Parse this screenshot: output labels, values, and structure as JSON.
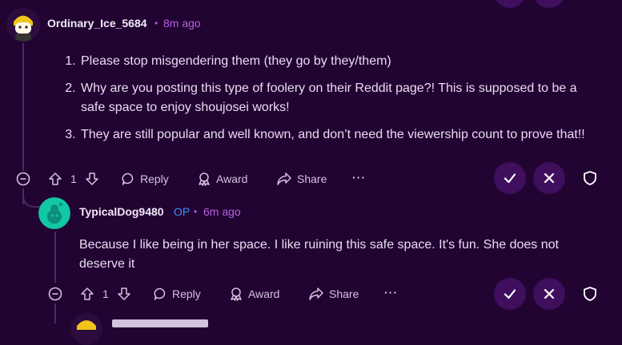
{
  "comments": [
    {
      "username": "Ordinary_Ice_5684",
      "separator": "•",
      "time": "8m ago",
      "list_items": [
        "Please stop misgendering them (they go by they/them)",
        "Why are you posting this type of foolery on their Reddit page?! This is supposed to be a safe space to enjoy shoujosei works!",
        "They are still popular and well known, and don’t need the viewership count to prove that!!"
      ],
      "actions": {
        "vote_count": "1",
        "reply_label": "Reply",
        "award_label": "Award",
        "share_label": "Share",
        "more_label": "···"
      }
    },
    {
      "username": "TypicalDog9480",
      "op_tag": "OP",
      "separator": "•",
      "time": "6m ago",
      "body": "Because I like being in her space. I like ruining this safe space. It's fun. She does not deserve it",
      "actions": {
        "vote_count": "1",
        "reply_label": "Reply",
        "award_label": "Award",
        "share_label": "Share",
        "more_label": "···"
      }
    }
  ],
  "colors": {
    "background": "#210432",
    "mod_button": "#3f0f5e",
    "meta_purple": "#b85fe0",
    "op_blue": "#3f8cff"
  },
  "icons": [
    "upvote-icon",
    "downvote-icon",
    "reply-icon",
    "award-icon",
    "share-icon",
    "more-icon",
    "approve-check-icon",
    "remove-x-icon",
    "shield-icon",
    "collapse-icon"
  ]
}
